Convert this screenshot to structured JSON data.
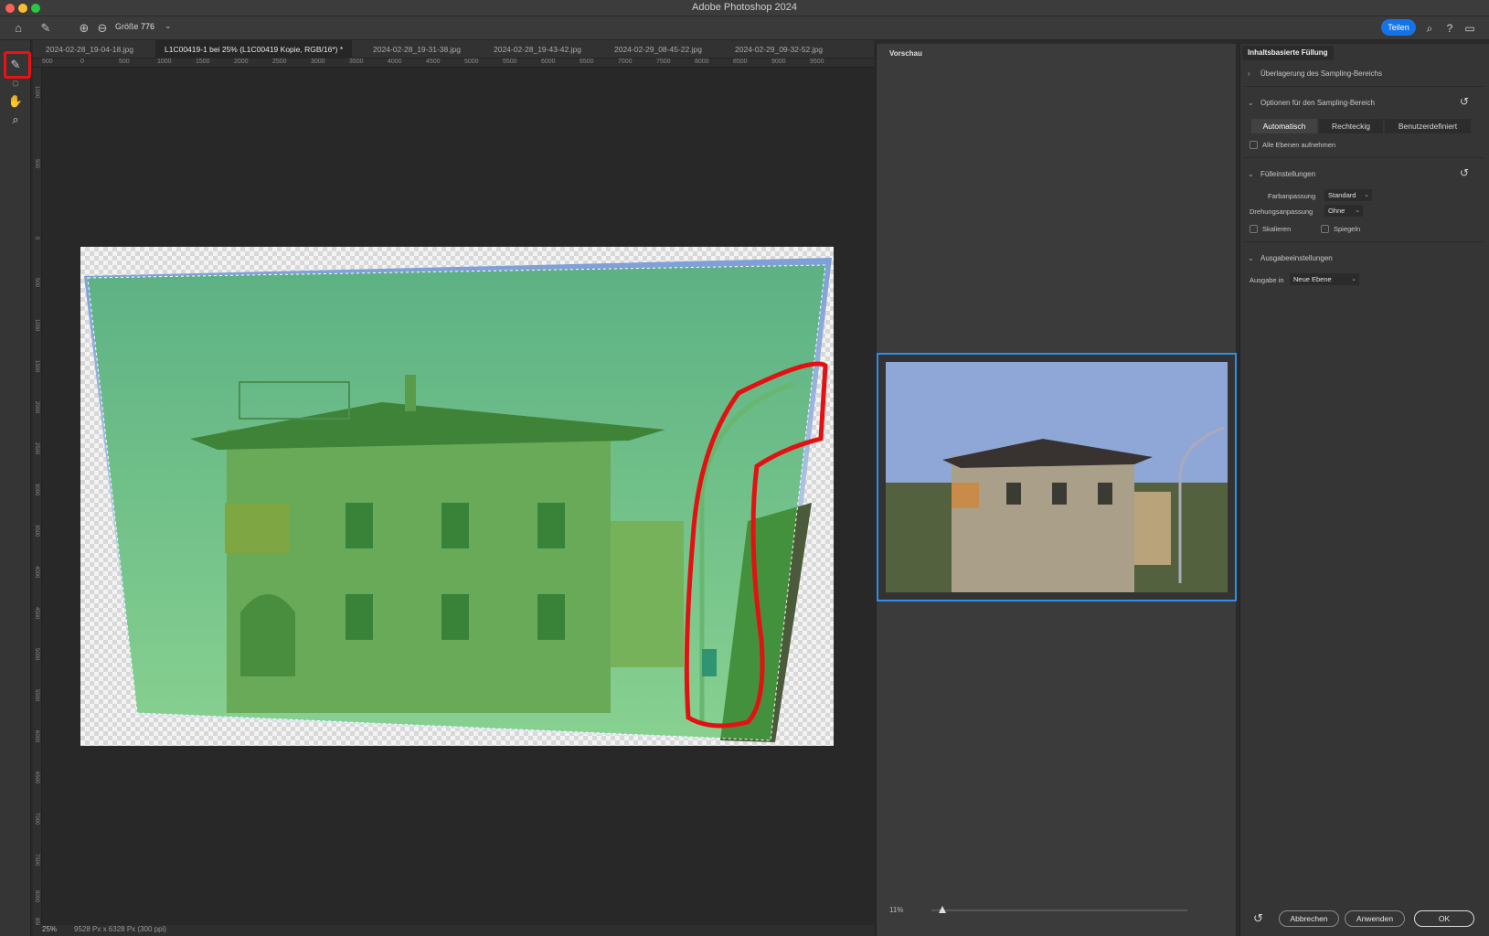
{
  "app": {
    "title": "Adobe Photoshop 2024"
  },
  "colors": {
    "accent": "#1473e6",
    "highlight": "#e11111",
    "selection_blue": "#2f8fe8",
    "green_overlay": "#4ec44e"
  },
  "options_bar": {
    "size_label": "Größe",
    "size_value": "776",
    "share_label": "Teilen",
    "icons": [
      "home-icon",
      "brush-icon",
      "add-circle-icon",
      "subtract-circle-icon",
      "search-icon",
      "help-icon",
      "workspace-icon"
    ]
  },
  "tools": [
    "sampling-brush-icon",
    "lasso-icon",
    "hand-icon",
    "zoom-icon"
  ],
  "tabs": [
    {
      "label": "2024-02-28_19-04-18.jpg"
    },
    {
      "label": "L1C00419-1 bei 25% (L1C00419 Kopie, RGB/16*) *"
    },
    {
      "label": "2024-02-28_19-31-38.jpg"
    },
    {
      "label": "2024-02-28_19-43-42.jpg"
    },
    {
      "label": "2024-02-29_08-45-22.jpg"
    },
    {
      "label": "2024-02-29_09-32-52.jpg"
    }
  ],
  "ruler_top": [
    "500",
    "0",
    "500",
    "1000",
    "1500",
    "2000",
    "2500",
    "3000",
    "3500",
    "4000",
    "4500",
    "5000",
    "5500",
    "6000",
    "6500",
    "7000",
    "7500",
    "8000",
    "8500",
    "9000",
    "9500"
  ],
  "ruler_left": [
    "1000",
    "500",
    "0",
    "500",
    "1000",
    "1500",
    "2000",
    "2500",
    "3000",
    "3500",
    "4000",
    "4500",
    "5000",
    "5500",
    "6000",
    "6500",
    "7000",
    "7500",
    "8000",
    "8500"
  ],
  "status": {
    "zoom": "25%",
    "doc_info": "9528 Px x 6328 Px (300 ppi)"
  },
  "preview": {
    "title": "Vorschau",
    "zoom": "11%"
  },
  "right_panel": {
    "tab": "Inhaltsbasierte Füllung",
    "sections": {
      "overlay": "Überlagerung des Sampling-Bereichs",
      "sampling_options": "Optionen für den Sampling-Bereich",
      "fill_settings": "Fülleinstellungen",
      "output_settings": "Ausgabeeinstellungen"
    },
    "sampling_modes": [
      "Automatisch",
      "Rechteckig",
      "Benutzerdefiniert"
    ],
    "all_layers": "Alle Ebenen aufnehmen",
    "color_adaptation_label": "Farbanpassung",
    "color_adaptation_value": "Standard",
    "rotation_label": "Drehungsanpassung",
    "rotation_value": "Ohne",
    "scale_label": "Skalieren",
    "mirror_label": "Spiegeln",
    "output_label": "Ausgabe in",
    "output_value": "Neue Ebene",
    "buttons": {
      "cancel": "Abbrechen",
      "apply": "Anwenden",
      "ok": "OK"
    }
  }
}
